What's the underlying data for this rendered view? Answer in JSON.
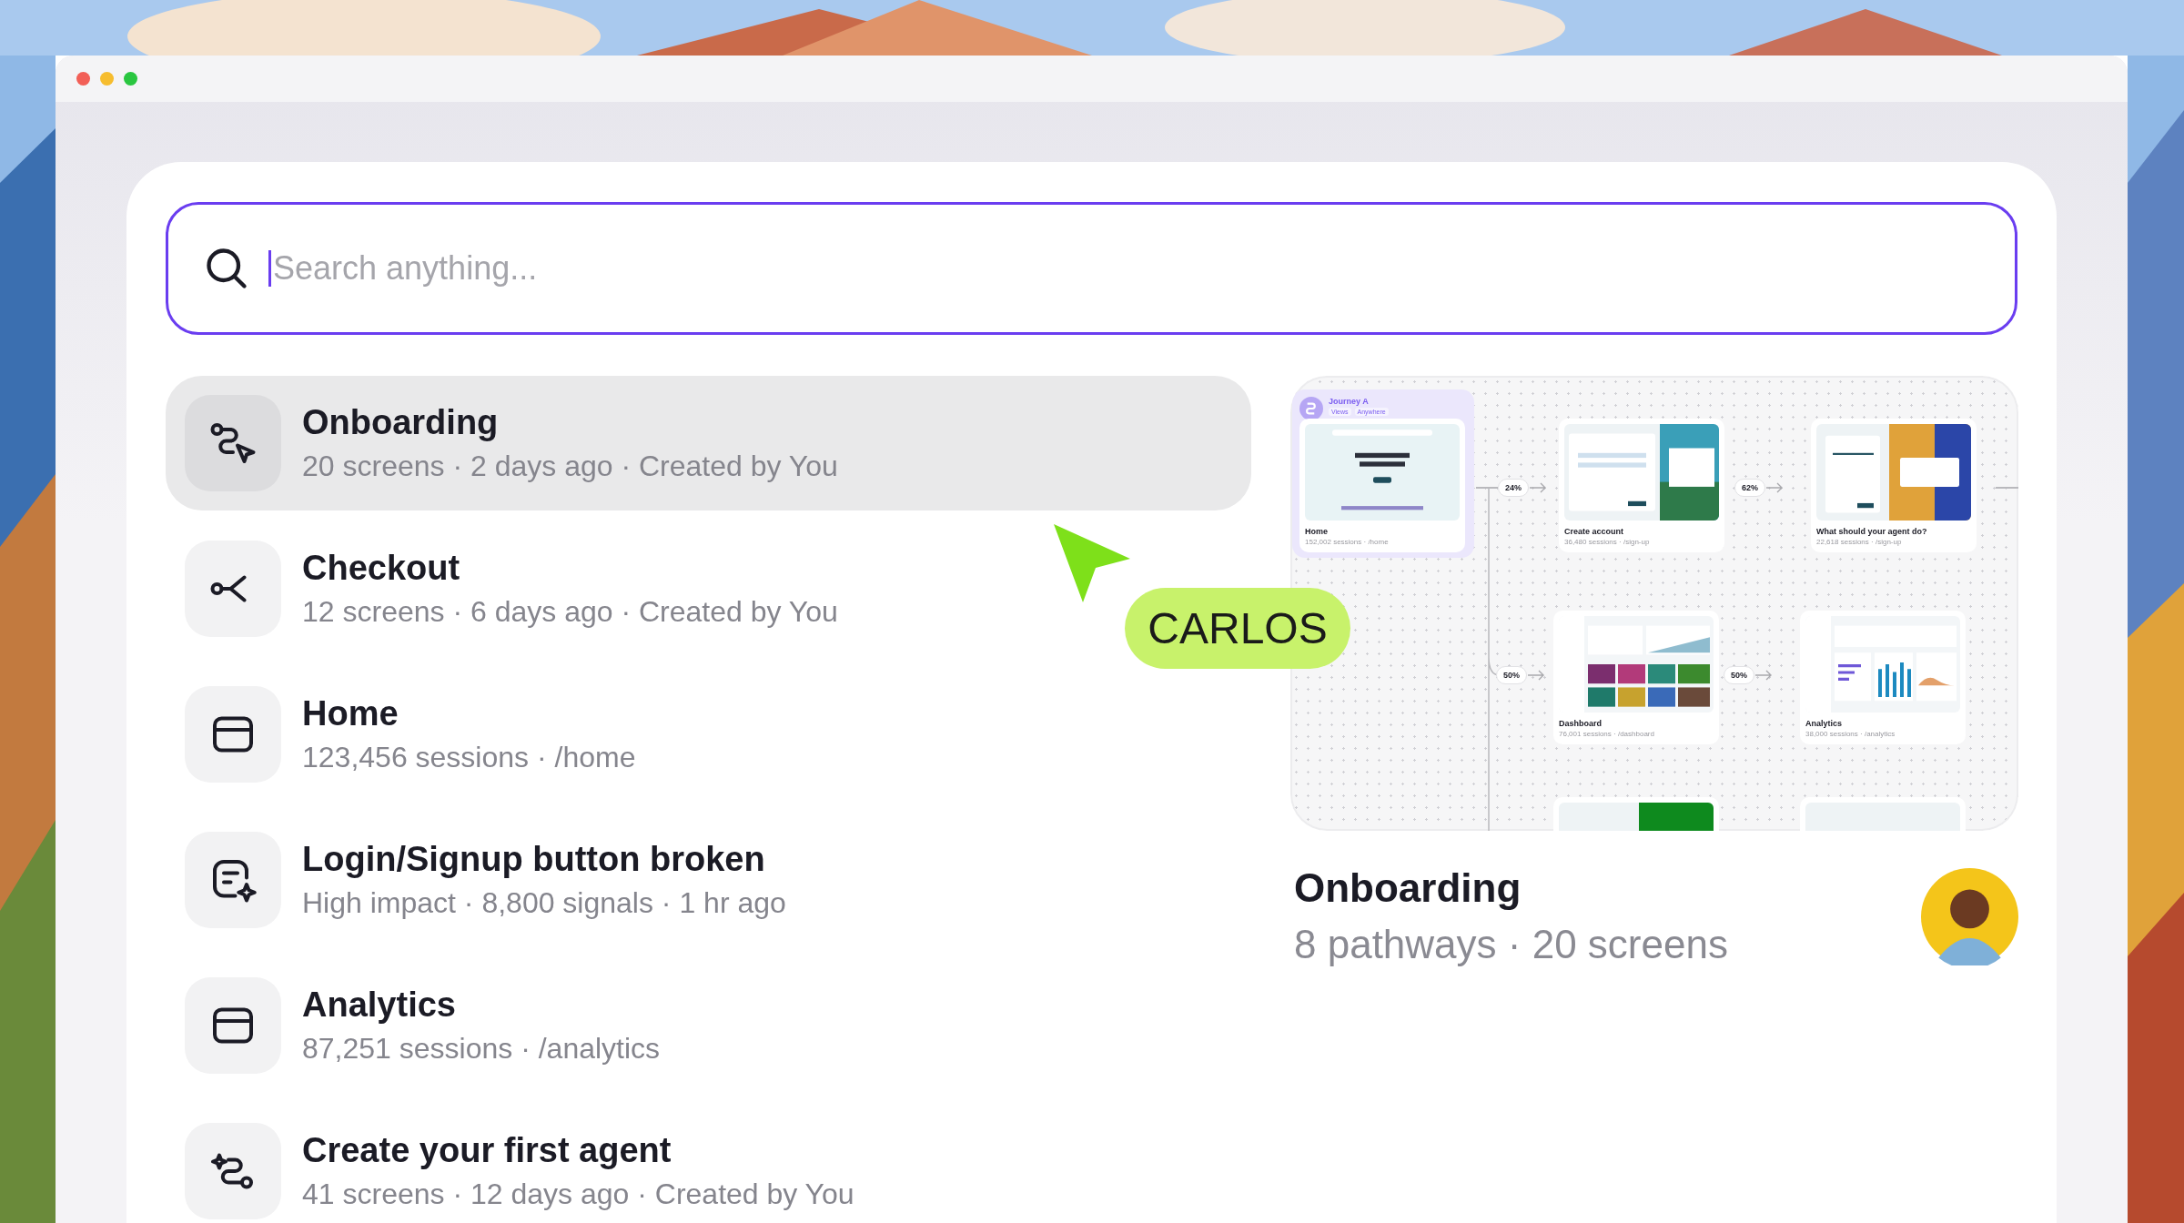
{
  "search": {
    "placeholder": "Search anything..."
  },
  "results": [
    {
      "kind": "flow",
      "title": "Onboarding",
      "subtitle": "20 screens · 2 days ago · Created by You",
      "selected": true
    },
    {
      "kind": "branch",
      "title": "Checkout",
      "subtitle": "12 screens · 6 days ago · Created by You",
      "selected": false
    },
    {
      "kind": "page",
      "title": "Home",
      "subtitle": "123,456 sessions · /home",
      "selected": false
    },
    {
      "kind": "issue",
      "title": "Login/Signup button broken",
      "subtitle": "High impact · 8,800 signals · 1 hr ago",
      "selected": false
    },
    {
      "kind": "page",
      "title": "Analytics",
      "subtitle": "87,251 sessions · /analytics",
      "selected": false
    },
    {
      "kind": "agent",
      "title": "Create your first agent",
      "subtitle": "41 screens · 12 days ago · Created by You",
      "selected": false
    }
  ],
  "preview": {
    "journey": {
      "title": "Journey A",
      "tags": [
        "Views",
        "Anywhere"
      ]
    },
    "nodes": [
      {
        "kind": "landing",
        "title": "Home",
        "subtitle": "152,002 sessions · /home"
      },
      {
        "kind": "signup",
        "title": "Create account",
        "subtitle": "36,480 sessions · /sign-up"
      },
      {
        "kind": "gradient",
        "title": "What should your agent do?",
        "subtitle": "22,618 sessions · /sign-up"
      },
      {
        "kind": "dashboard",
        "title": "Dashboard",
        "subtitle": "76,001 sessions · /dashboard"
      },
      {
        "kind": "analytics",
        "title": "Analytics",
        "subtitle": "38,000 sessions · /analytics"
      }
    ],
    "edges": [
      {
        "label": "24%"
      },
      {
        "label": "62%"
      },
      {
        "label": "50%"
      },
      {
        "label": "50%"
      }
    ],
    "title": "Onboarding",
    "subtitle": "8 pathways · 20 screens"
  },
  "cursor": {
    "label": "CARLOS",
    "color": "#c8f26b"
  }
}
